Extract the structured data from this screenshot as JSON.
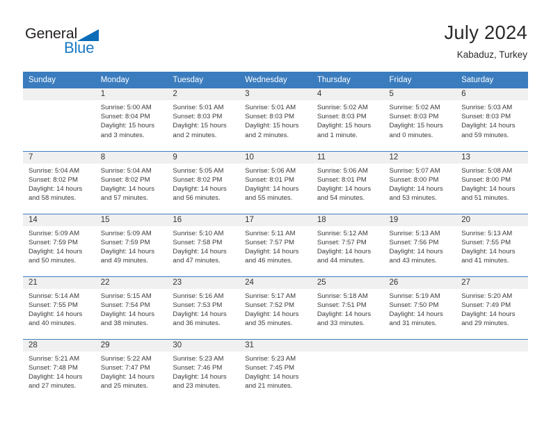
{
  "brand": {
    "word1": "General",
    "word2": "Blue",
    "triangle_color": "#0b6cb7",
    "text_color": "#231f20",
    "blue_color": "#1878c4"
  },
  "header": {
    "title": "July 2024",
    "subtitle": "Kabaduz, Turkey",
    "header_bg": "#3a7cbe",
    "header_text": "#ffffff"
  },
  "weekdays": [
    "Sunday",
    "Monday",
    "Tuesday",
    "Wednesday",
    "Thursday",
    "Friday",
    "Saturday"
  ],
  "weeks": [
    [
      {
        "day": "",
        "sunrise": "",
        "sunset": "",
        "daylight1": "",
        "daylight2": ""
      },
      {
        "day": "1",
        "sunrise": "Sunrise: 5:00 AM",
        "sunset": "Sunset: 8:04 PM",
        "daylight1": "Daylight: 15 hours",
        "daylight2": "and 3 minutes."
      },
      {
        "day": "2",
        "sunrise": "Sunrise: 5:01 AM",
        "sunset": "Sunset: 8:03 PM",
        "daylight1": "Daylight: 15 hours",
        "daylight2": "and 2 minutes."
      },
      {
        "day": "3",
        "sunrise": "Sunrise: 5:01 AM",
        "sunset": "Sunset: 8:03 PM",
        "daylight1": "Daylight: 15 hours",
        "daylight2": "and 2 minutes."
      },
      {
        "day": "4",
        "sunrise": "Sunrise: 5:02 AM",
        "sunset": "Sunset: 8:03 PM",
        "daylight1": "Daylight: 15 hours",
        "daylight2": "and 1 minute."
      },
      {
        "day": "5",
        "sunrise": "Sunrise: 5:02 AM",
        "sunset": "Sunset: 8:03 PM",
        "daylight1": "Daylight: 15 hours",
        "daylight2": "and 0 minutes."
      },
      {
        "day": "6",
        "sunrise": "Sunrise: 5:03 AM",
        "sunset": "Sunset: 8:03 PM",
        "daylight1": "Daylight: 14 hours",
        "daylight2": "and 59 minutes."
      }
    ],
    [
      {
        "day": "7",
        "sunrise": "Sunrise: 5:04 AM",
        "sunset": "Sunset: 8:02 PM",
        "daylight1": "Daylight: 14 hours",
        "daylight2": "and 58 minutes."
      },
      {
        "day": "8",
        "sunrise": "Sunrise: 5:04 AM",
        "sunset": "Sunset: 8:02 PM",
        "daylight1": "Daylight: 14 hours",
        "daylight2": "and 57 minutes."
      },
      {
        "day": "9",
        "sunrise": "Sunrise: 5:05 AM",
        "sunset": "Sunset: 8:02 PM",
        "daylight1": "Daylight: 14 hours",
        "daylight2": "and 56 minutes."
      },
      {
        "day": "10",
        "sunrise": "Sunrise: 5:06 AM",
        "sunset": "Sunset: 8:01 PM",
        "daylight1": "Daylight: 14 hours",
        "daylight2": "and 55 minutes."
      },
      {
        "day": "11",
        "sunrise": "Sunrise: 5:06 AM",
        "sunset": "Sunset: 8:01 PM",
        "daylight1": "Daylight: 14 hours",
        "daylight2": "and 54 minutes."
      },
      {
        "day": "12",
        "sunrise": "Sunrise: 5:07 AM",
        "sunset": "Sunset: 8:00 PM",
        "daylight1": "Daylight: 14 hours",
        "daylight2": "and 53 minutes."
      },
      {
        "day": "13",
        "sunrise": "Sunrise: 5:08 AM",
        "sunset": "Sunset: 8:00 PM",
        "daylight1": "Daylight: 14 hours",
        "daylight2": "and 51 minutes."
      }
    ],
    [
      {
        "day": "14",
        "sunrise": "Sunrise: 5:09 AM",
        "sunset": "Sunset: 7:59 PM",
        "daylight1": "Daylight: 14 hours",
        "daylight2": "and 50 minutes."
      },
      {
        "day": "15",
        "sunrise": "Sunrise: 5:09 AM",
        "sunset": "Sunset: 7:59 PM",
        "daylight1": "Daylight: 14 hours",
        "daylight2": "and 49 minutes."
      },
      {
        "day": "16",
        "sunrise": "Sunrise: 5:10 AM",
        "sunset": "Sunset: 7:58 PM",
        "daylight1": "Daylight: 14 hours",
        "daylight2": "and 47 minutes."
      },
      {
        "day": "17",
        "sunrise": "Sunrise: 5:11 AM",
        "sunset": "Sunset: 7:57 PM",
        "daylight1": "Daylight: 14 hours",
        "daylight2": "and 46 minutes."
      },
      {
        "day": "18",
        "sunrise": "Sunrise: 5:12 AM",
        "sunset": "Sunset: 7:57 PM",
        "daylight1": "Daylight: 14 hours",
        "daylight2": "and 44 minutes."
      },
      {
        "day": "19",
        "sunrise": "Sunrise: 5:13 AM",
        "sunset": "Sunset: 7:56 PM",
        "daylight1": "Daylight: 14 hours",
        "daylight2": "and 43 minutes."
      },
      {
        "day": "20",
        "sunrise": "Sunrise: 5:13 AM",
        "sunset": "Sunset: 7:55 PM",
        "daylight1": "Daylight: 14 hours",
        "daylight2": "and 41 minutes."
      }
    ],
    [
      {
        "day": "21",
        "sunrise": "Sunrise: 5:14 AM",
        "sunset": "Sunset: 7:55 PM",
        "daylight1": "Daylight: 14 hours",
        "daylight2": "and 40 minutes."
      },
      {
        "day": "22",
        "sunrise": "Sunrise: 5:15 AM",
        "sunset": "Sunset: 7:54 PM",
        "daylight1": "Daylight: 14 hours",
        "daylight2": "and 38 minutes."
      },
      {
        "day": "23",
        "sunrise": "Sunrise: 5:16 AM",
        "sunset": "Sunset: 7:53 PM",
        "daylight1": "Daylight: 14 hours",
        "daylight2": "and 36 minutes."
      },
      {
        "day": "24",
        "sunrise": "Sunrise: 5:17 AM",
        "sunset": "Sunset: 7:52 PM",
        "daylight1": "Daylight: 14 hours",
        "daylight2": "and 35 minutes."
      },
      {
        "day": "25",
        "sunrise": "Sunrise: 5:18 AM",
        "sunset": "Sunset: 7:51 PM",
        "daylight1": "Daylight: 14 hours",
        "daylight2": "and 33 minutes."
      },
      {
        "day": "26",
        "sunrise": "Sunrise: 5:19 AM",
        "sunset": "Sunset: 7:50 PM",
        "daylight1": "Daylight: 14 hours",
        "daylight2": "and 31 minutes."
      },
      {
        "day": "27",
        "sunrise": "Sunrise: 5:20 AM",
        "sunset": "Sunset: 7:49 PM",
        "daylight1": "Daylight: 14 hours",
        "daylight2": "and 29 minutes."
      }
    ],
    [
      {
        "day": "28",
        "sunrise": "Sunrise: 5:21 AM",
        "sunset": "Sunset: 7:48 PM",
        "daylight1": "Daylight: 14 hours",
        "daylight2": "and 27 minutes."
      },
      {
        "day": "29",
        "sunrise": "Sunrise: 5:22 AM",
        "sunset": "Sunset: 7:47 PM",
        "daylight1": "Daylight: 14 hours",
        "daylight2": "and 25 minutes."
      },
      {
        "day": "30",
        "sunrise": "Sunrise: 5:23 AM",
        "sunset": "Sunset: 7:46 PM",
        "daylight1": "Daylight: 14 hours",
        "daylight2": "and 23 minutes."
      },
      {
        "day": "31",
        "sunrise": "Sunrise: 5:23 AM",
        "sunset": "Sunset: 7:45 PM",
        "daylight1": "Daylight: 14 hours",
        "daylight2": "and 21 minutes."
      },
      {
        "day": "",
        "sunrise": "",
        "sunset": "",
        "daylight1": "",
        "daylight2": ""
      },
      {
        "day": "",
        "sunrise": "",
        "sunset": "",
        "daylight1": "",
        "daylight2": ""
      },
      {
        "day": "",
        "sunrise": "",
        "sunset": "",
        "daylight1": "",
        "daylight2": ""
      }
    ]
  ]
}
